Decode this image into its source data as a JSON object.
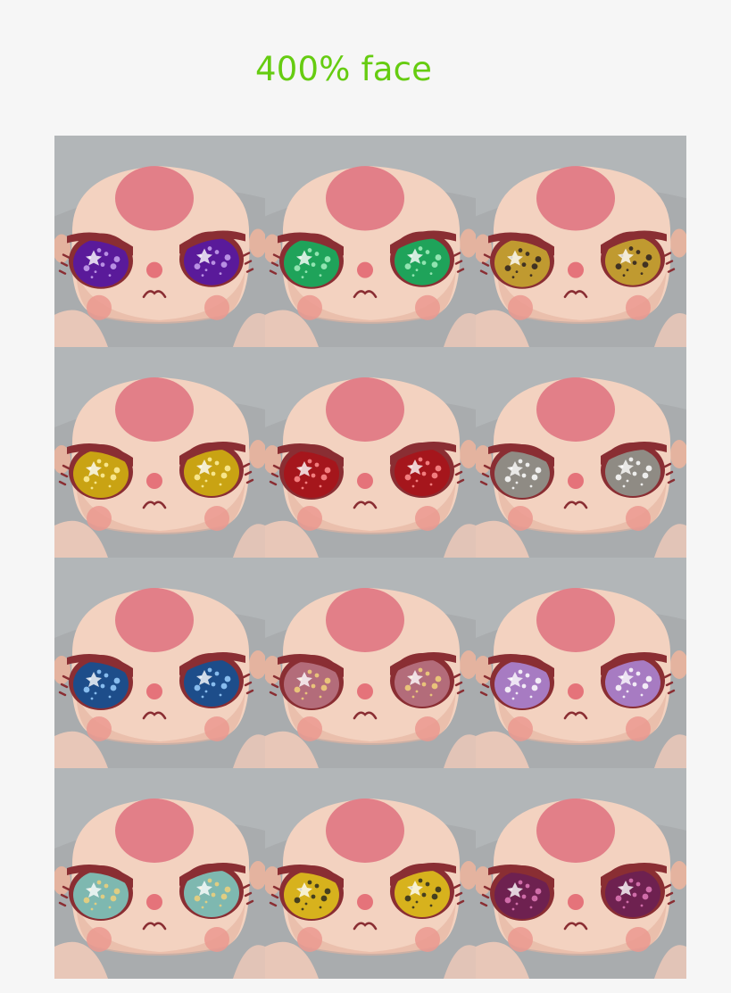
{
  "title": {
    "text": "400% face",
    "color": "#66cc11"
  },
  "palette": {
    "background": "#f6f6f6",
    "backdrop": "#a9acae",
    "skin": "#f3d2c0",
    "skin_shadow": "#e4b39f",
    "forehead": "#e27f88",
    "eyelid": "#8a2e33",
    "blush": "#eb998f",
    "nose": "#e5737a",
    "hand": "#e8c7b8"
  },
  "faces": [
    {
      "label": "face-purple",
      "iris_color": "#5a1a9a",
      "sparkle_color": "#c9a4f0"
    },
    {
      "label": "face-green",
      "iris_color": "#1fa35a",
      "sparkle_color": "#a5f0c0"
    },
    {
      "label": "face-gold-black",
      "iris_color": "#c09a30",
      "sparkle_color": "#2a2020"
    },
    {
      "label": "face-gold",
      "iris_color": "#c9a313",
      "sparkle_color": "#fff1a0"
    },
    {
      "label": "face-red",
      "iris_color": "#a5161c",
      "sparkle_color": "#ff8f8f"
    },
    {
      "label": "face-silver",
      "iris_color": "#8f8b84",
      "sparkle_color": "#ffffff"
    },
    {
      "label": "face-blue",
      "iris_color": "#1d4d8a",
      "sparkle_color": "#9ad0ff"
    },
    {
      "label": "face-pink-gold",
      "iris_color": "#b36c7a",
      "sparkle_color": "#f2d27a"
    },
    {
      "label": "face-lavender",
      "iris_color": "#a77bc2",
      "sparkle_color": "#ffffff"
    },
    {
      "label": "face-aqua-gold",
      "iris_color": "#7eb8b0",
      "sparkle_color": "#f0d07a"
    },
    {
      "label": "face-yellow-black",
      "iris_color": "#d7b21d",
      "sparkle_color": "#2b2a20"
    },
    {
      "label": "face-magenta",
      "iris_color": "#6e2150",
      "sparkle_color": "#e27ab8"
    }
  ]
}
